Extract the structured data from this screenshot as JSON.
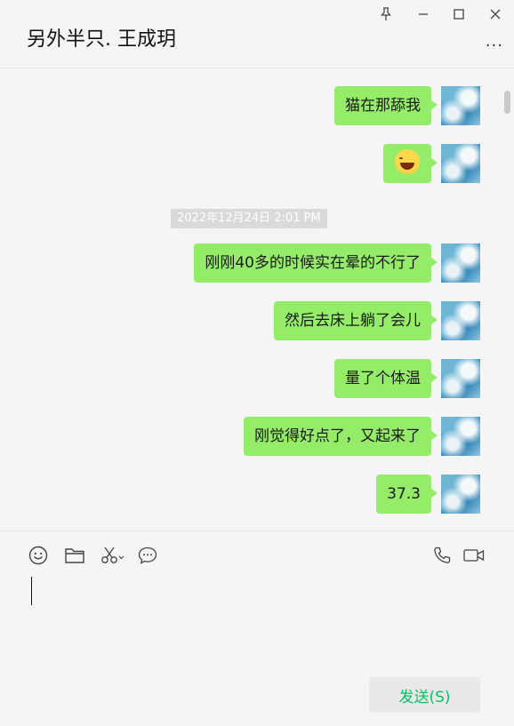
{
  "window": {
    "title": "另外半只. 王成玥",
    "more_label": "..."
  },
  "messages": [
    {
      "sender": "self",
      "type": "text",
      "text": "猫在那舔我"
    },
    {
      "sender": "self",
      "type": "emoji",
      "text": "",
      "emoji_name": "laughing-crying-emoji"
    },
    {
      "sender": "self",
      "type": "text",
      "text": "刚刚40多的时候实在晕的不行了"
    },
    {
      "sender": "self",
      "type": "text",
      "text": "然后去床上躺了会儿"
    },
    {
      "sender": "self",
      "type": "text",
      "text": "量了个体温"
    },
    {
      "sender": "self",
      "type": "text",
      "text": "刚觉得好点了，又起来了"
    },
    {
      "sender": "self",
      "type": "text",
      "text": "37.3"
    }
  ],
  "timestamp": "2022年12月24日 2:01 PM",
  "toolbar": {
    "icons": [
      "smiley-icon",
      "folder-icon",
      "scissors-icon",
      "chat-bubble-icon",
      "phone-icon",
      "video-camera-icon"
    ]
  },
  "input": {
    "value": ""
  },
  "send_button": {
    "label": "发送(S)"
  },
  "colors": {
    "bubble_self": "#95ec69",
    "send_text": "#07c160",
    "timestamp_bg": "#dadada"
  }
}
